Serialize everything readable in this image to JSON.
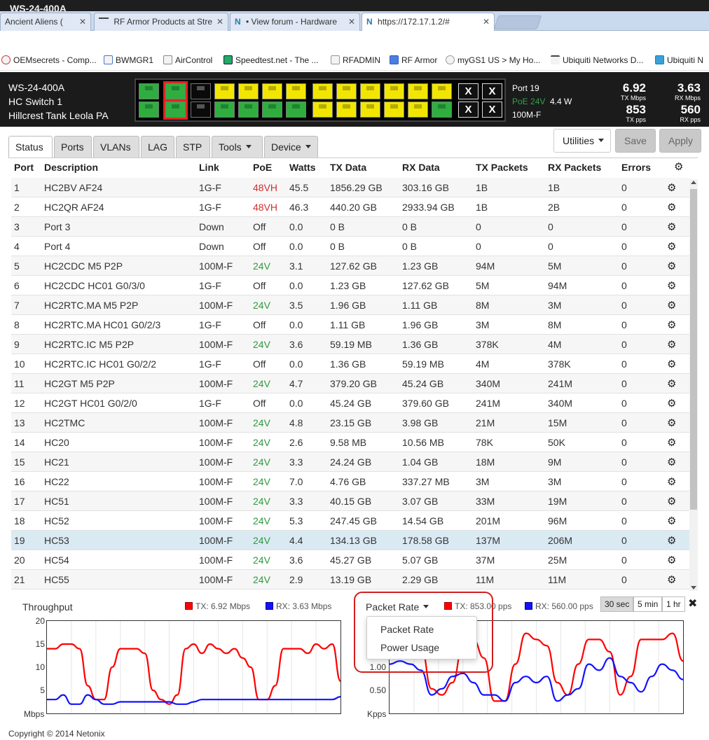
{
  "browser": {
    "top_title": "WS-24-400A",
    "tabs": [
      {
        "label": "Ancient Aliens (",
        "favicon": "",
        "active": false
      },
      {
        "label": "RF Armor Products at Stre",
        "favicon": "",
        "active": false
      },
      {
        "label": "• View forum - Hardware",
        "favicon": "N",
        "active": false
      },
      {
        "label": "https://172.17.1.2/#",
        "favicon": "N",
        "active": true
      }
    ],
    "bookmarks": [
      "OEMsecrets - Comp...",
      "BWMGR1",
      "AirControl",
      "Speedtest.net - The ...",
      "RFADMIN",
      "RF Armor",
      "myGS1 US > My Ho...",
      "Ubiquiti Networks D...",
      "Ubiquiti N"
    ]
  },
  "device": {
    "model": "WS-24-400A",
    "name": "HC Switch 1",
    "location": "Hillcrest Tank Leola PA"
  },
  "port_info": {
    "port": "Port 19",
    "poe": "PoE 24V",
    "watts": "4.4 W",
    "link": "100M-F"
  },
  "stats": {
    "tx_mbps": "6.92",
    "tx_mbps_label": "TX Mbps",
    "rx_mbps": "3.63",
    "rx_mbps_label": "RX Mbps",
    "tx_pps": "853",
    "tx_pps_label": "TX pps",
    "rx_pps": "560",
    "rx_pps_label": "RX pps"
  },
  "nav": {
    "tabs": [
      "Status",
      "Ports",
      "VLANs",
      "LAG",
      "STP",
      "Tools",
      "Device"
    ],
    "utilities": "Utilities",
    "save": "Save",
    "apply": "Apply"
  },
  "table": {
    "headers": [
      "Port",
      "Description",
      "Link",
      "PoE",
      "Watts",
      "TX Data",
      "RX Data",
      "TX Packets",
      "RX Packets",
      "Errors"
    ],
    "rows": [
      [
        "1",
        "HC2BV AF24",
        "1G-F",
        "48VH",
        "45.5",
        "1856.29 GB",
        "303.16 GB",
        "1B",
        "1B",
        "0"
      ],
      [
        "2",
        "HC2QR AF24",
        "1G-F",
        "48VH",
        "46.3",
        "440.20 GB",
        "2933.94 GB",
        "1B",
        "2B",
        "0"
      ],
      [
        "3",
        "Port 3",
        "Down",
        "Off",
        "0.0",
        "0 B",
        "0 B",
        "0",
        "0",
        "0"
      ],
      [
        "4",
        "Port 4",
        "Down",
        "Off",
        "0.0",
        "0 B",
        "0 B",
        "0",
        "0",
        "0"
      ],
      [
        "5",
        "HC2CDC M5 P2P",
        "100M-F",
        "24V",
        "3.1",
        "127.62 GB",
        "1.23 GB",
        "94M",
        "5M",
        "0"
      ],
      [
        "6",
        "HC2CDC HC01 G0/3/0",
        "1G-F",
        "Off",
        "0.0",
        "1.23 GB",
        "127.62 GB",
        "5M",
        "94M",
        "0"
      ],
      [
        "7",
        "HC2RTC.MA M5 P2P",
        "100M-F",
        "24V",
        "3.5",
        "1.96 GB",
        "1.11 GB",
        "8M",
        "3M",
        "0"
      ],
      [
        "8",
        "HC2RTC.MA HC01 G0/2/3",
        "1G-F",
        "Off",
        "0.0",
        "1.11 GB",
        "1.96 GB",
        "3M",
        "8M",
        "0"
      ],
      [
        "9",
        "HC2RTC.IC M5 P2P",
        "100M-F",
        "24V",
        "3.6",
        "59.19 MB",
        "1.36 GB",
        "378K",
        "4M",
        "0"
      ],
      [
        "10",
        "HC2RTC.IC HC01 G0/2/2",
        "1G-F",
        "Off",
        "0.0",
        "1.36 GB",
        "59.19 MB",
        "4M",
        "378K",
        "0"
      ],
      [
        "11",
        "HC2GT M5 P2P",
        "100M-F",
        "24V",
        "4.7",
        "379.20 GB",
        "45.24 GB",
        "340M",
        "241M",
        "0"
      ],
      [
        "12",
        "HC2GT HC01 G0/2/0",
        "1G-F",
        "Off",
        "0.0",
        "45.24 GB",
        "379.60 GB",
        "241M",
        "340M",
        "0"
      ],
      [
        "13",
        "HC2TMC",
        "100M-F",
        "24V",
        "4.8",
        "23.15 GB",
        "3.98 GB",
        "21M",
        "15M",
        "0"
      ],
      [
        "14",
        "HC20",
        "100M-F",
        "24V",
        "2.6",
        "9.58 MB",
        "10.56 MB",
        "78K",
        "50K",
        "0"
      ],
      [
        "15",
        "HC21",
        "100M-F",
        "24V",
        "3.3",
        "24.24 GB",
        "1.04 GB",
        "18M",
        "9M",
        "0"
      ],
      [
        "16",
        "HC22",
        "100M-F",
        "24V",
        "7.0",
        "4.76 GB",
        "337.27 MB",
        "3M",
        "3M",
        "0"
      ],
      [
        "17",
        "HC51",
        "100M-F",
        "24V",
        "3.3",
        "40.15 GB",
        "3.07 GB",
        "33M",
        "19M",
        "0"
      ],
      [
        "18",
        "HC52",
        "100M-F",
        "24V",
        "5.3",
        "247.45 GB",
        "14.54 GB",
        "201M",
        "96M",
        "0"
      ],
      [
        "19",
        "HC53",
        "100M-F",
        "24V",
        "4.4",
        "134.13 GB",
        "178.58 GB",
        "137M",
        "206M",
        "0"
      ],
      [
        "20",
        "HC54",
        "100M-F",
        "24V",
        "3.6",
        "45.27 GB",
        "5.07 GB",
        "37M",
        "25M",
        "0"
      ],
      [
        "21",
        "HC55",
        "100M-F",
        "24V",
        "2.9",
        "13.19 GB",
        "2.29 GB",
        "11M",
        "11M",
        "0"
      ]
    ],
    "selected_port": "19"
  },
  "throughput": {
    "title": "Throughput",
    "tx_legend": "TX: 6.92 Mbps",
    "rx_legend": "RX: 3.63 Mbps",
    "unit": "Mbps",
    "yticks": [
      "20",
      "15",
      "10",
      "5"
    ]
  },
  "packet": {
    "title": "Packet Rate",
    "tx_legend": "TX: 853.00 pps",
    "rx_legend": "RX: 560.00 pps",
    "unit": "Kpps",
    "yticks": [
      "1.00",
      "0.50"
    ],
    "menu": [
      "Packet Rate",
      "Power Usage"
    ]
  },
  "time_buttons": [
    "30 sec",
    "5 min",
    "1 hr"
  ],
  "copyright": "Copyright © 2014 Netonix",
  "colors": {
    "tx": "#ff0000",
    "rx": "#1212ff",
    "accent_red": "#d21e1e",
    "poe_green": "#2d9a3d"
  },
  "chart_data": [
    {
      "type": "line",
      "title": "Throughput",
      "ylabel": "Mbps",
      "ylim": [
        0,
        20
      ],
      "grid": true,
      "legend": "top-right",
      "series": [
        {
          "name": "TX: 6.92 Mbps",
          "values": [
            14,
            14,
            15,
            15,
            14,
            6,
            3,
            3,
            10,
            14,
            14,
            14,
            13,
            5,
            3,
            2,
            4,
            14,
            15,
            13,
            15,
            14,
            13,
            14,
            12,
            10,
            3,
            3,
            6,
            14,
            14,
            14,
            13,
            15,
            14,
            15,
            7
          ]
        },
        {
          "name": "RX: 3.63 Mbps",
          "values": [
            3,
            3,
            4,
            2,
            2,
            4,
            3,
            2,
            2,
            2.5,
            2.5,
            2.5,
            2.5,
            2.5,
            2.5,
            2.5,
            2,
            2,
            2.5,
            3,
            3,
            3,
            3,
            3,
            3,
            3,
            3,
            3,
            3,
            3,
            3,
            3,
            3,
            3,
            3,
            3,
            3.6
          ]
        }
      ]
    },
    {
      "type": "line",
      "title": "Packet Rate",
      "ylabel": "Kpps",
      "ylim": [
        0,
        1.5
      ],
      "grid": true,
      "legend": "top-right",
      "series": [
        {
          "name": "TX: 853.00 pps",
          "values": [
            1.2,
            1.2,
            1.25,
            1.1,
            0.4,
            0.3,
            0.5,
            1.1,
            1.2,
            0.9,
            0.2,
            0.2,
            0.8,
            1.3,
            1.2,
            1.1,
            0.5,
            0.3,
            0.8,
            1.2,
            1.2,
            1.0,
            0.3,
            0.6,
            1.2,
            1.2,
            1.2,
            1.3,
            0.85
          ]
        },
        {
          "name": "RX: 560.00 pps",
          "values": [
            0.8,
            0.85,
            0.8,
            0.7,
            0.3,
            0.4,
            0.6,
            0.65,
            0.5,
            0.3,
            0.3,
            0.2,
            0.5,
            0.6,
            0.5,
            0.6,
            0.2,
            0.3,
            0.4,
            0.8,
            0.7,
            0.9,
            0.6,
            0.5,
            0.35,
            0.6,
            0.8,
            0.7,
            0.55
          ]
        }
      ]
    }
  ]
}
